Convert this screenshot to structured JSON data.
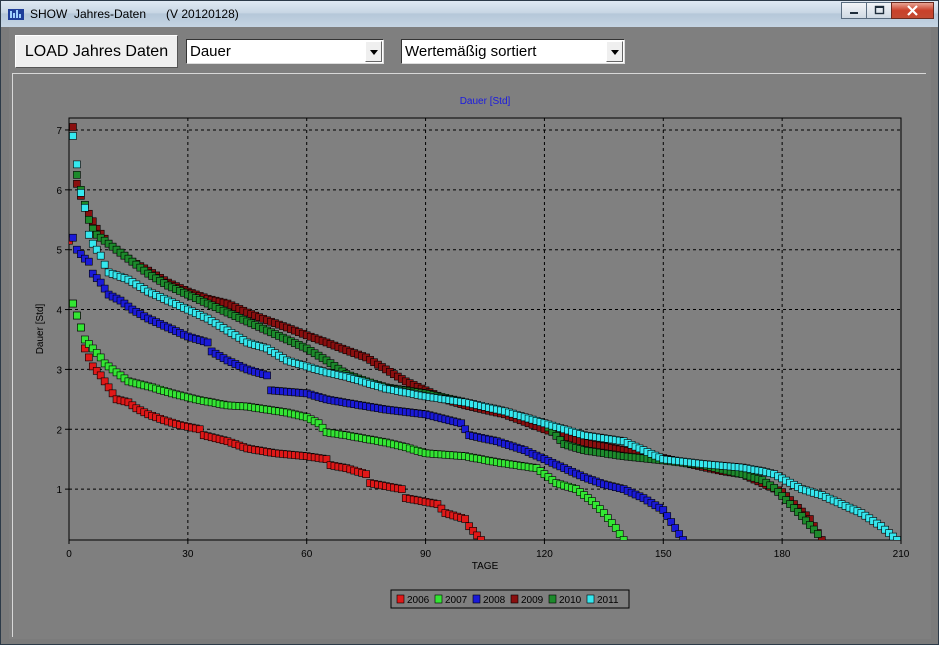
{
  "window": {
    "title": "SHOW  Jahres-Daten      (V 20120128)",
    "buttons": [
      "minimize",
      "maximize",
      "close"
    ]
  },
  "toolbar": {
    "load_label": "LOAD Jahres Daten",
    "measure_select": "Dauer",
    "sort_select": "Wertemäßig sortiert"
  },
  "colors": {
    "2006": "#e01818",
    "2007": "#33e633",
    "2008": "#1a1ad8",
    "2009": "#8a0f0f",
    "2010": "#1d8a2c",
    "2011": "#35e8ef",
    "plot_bg": "#808080",
    "title_color": "#1a1ae0"
  },
  "chart_data": {
    "type": "scatter",
    "title": "Dauer   [Std]",
    "xlabel": "TAGE",
    "ylabel": "Dauer   [Std]",
    "xlim": [
      0,
      210
    ],
    "ylim": [
      0.15,
      7.2
    ],
    "xticks": [
      "0",
      "30",
      "60",
      "90",
      "120",
      "150",
      "180",
      "210"
    ],
    "yticks": [
      "1",
      "2",
      "3",
      "4",
      "5",
      "6",
      "7"
    ],
    "grid": true,
    "legend_position": "bottom-center",
    "series": [
      {
        "name": "2006",
        "n": 104,
        "points": [
          [
            0,
            5.15
          ],
          [
            1,
            4.1
          ],
          [
            3,
            3.7
          ],
          [
            4,
            3.35
          ],
          [
            5,
            3.2
          ],
          [
            6,
            3.05
          ],
          [
            8,
            2.9
          ],
          [
            10,
            2.7
          ],
          [
            11,
            2.6
          ],
          [
            12,
            2.5
          ],
          [
            15,
            2.45
          ],
          [
            17,
            2.35
          ],
          [
            20,
            2.25
          ],
          [
            24,
            2.15
          ],
          [
            28,
            2.07
          ],
          [
            33,
            2.0
          ],
          [
            34,
            1.9
          ],
          [
            40,
            1.8
          ],
          [
            45,
            1.68
          ],
          [
            52,
            1.6
          ],
          [
            60,
            1.55
          ],
          [
            65,
            1.5
          ],
          [
            66,
            1.4
          ],
          [
            70,
            1.35
          ],
          [
            75,
            1.25
          ],
          [
            76,
            1.1
          ],
          [
            84,
            1.0
          ],
          [
            85,
            0.85
          ],
          [
            93,
            0.75
          ],
          [
            95,
            0.6
          ],
          [
            100,
            0.5
          ],
          [
            101,
            0.38
          ],
          [
            104,
            0.15
          ]
        ]
      },
      {
        "name": "2007",
        "n": 140,
        "points": [
          [
            1,
            4.1
          ],
          [
            4,
            3.5
          ],
          [
            6,
            3.35
          ],
          [
            8,
            3.2
          ],
          [
            9,
            3.1
          ],
          [
            12,
            2.95
          ],
          [
            15,
            2.8
          ],
          [
            21,
            2.7
          ],
          [
            26,
            2.6
          ],
          [
            32,
            2.5
          ],
          [
            40,
            2.4
          ],
          [
            45,
            2.38
          ],
          [
            55,
            2.28
          ],
          [
            60,
            2.2
          ],
          [
            63,
            2.1
          ],
          [
            65,
            1.95
          ],
          [
            70,
            1.9
          ],
          [
            80,
            1.78
          ],
          [
            85,
            1.7
          ],
          [
            90,
            1.6
          ],
          [
            100,
            1.55
          ],
          [
            108,
            1.45
          ],
          [
            118,
            1.35
          ],
          [
            120,
            1.25
          ],
          [
            123,
            1.1
          ],
          [
            128,
            1.0
          ],
          [
            132,
            0.8
          ],
          [
            135,
            0.6
          ],
          [
            138,
            0.35
          ],
          [
            140,
            0.15
          ]
        ]
      },
      {
        "name": "2008",
        "n": 156,
        "points": [
          [
            1,
            5.2
          ],
          [
            2,
            5.0
          ],
          [
            4,
            4.85
          ],
          [
            5,
            4.8
          ],
          [
            6,
            4.6
          ],
          [
            8,
            4.45
          ],
          [
            10,
            4.25
          ],
          [
            13,
            4.15
          ],
          [
            16,
            4.0
          ],
          [
            20,
            3.85
          ],
          [
            25,
            3.7
          ],
          [
            30,
            3.55
          ],
          [
            35,
            3.45
          ],
          [
            36,
            3.3
          ],
          [
            40,
            3.15
          ],
          [
            45,
            3.0
          ],
          [
            50,
            2.9
          ],
          [
            51,
            2.65
          ],
          [
            60,
            2.6
          ],
          [
            65,
            2.5
          ],
          [
            71,
            2.43
          ],
          [
            80,
            2.33
          ],
          [
            90,
            2.25
          ],
          [
            99,
            2.1
          ],
          [
            101,
            1.9
          ],
          [
            108,
            1.8
          ],
          [
            115,
            1.65
          ],
          [
            120,
            1.5
          ],
          [
            125,
            1.35
          ],
          [
            130,
            1.2
          ],
          [
            135,
            1.08
          ],
          [
            140,
            1.0
          ],
          [
            145,
            0.85
          ],
          [
            150,
            0.65
          ],
          [
            152,
            0.45
          ],
          [
            155,
            0.15
          ]
        ]
      },
      {
        "name": "2009",
        "n": 190,
        "points": [
          [
            1,
            7.05
          ],
          [
            2,
            6.1
          ],
          [
            3,
            5.9
          ],
          [
            5,
            5.6
          ],
          [
            7,
            5.35
          ],
          [
            10,
            5.1
          ],
          [
            13,
            4.95
          ],
          [
            16,
            4.8
          ],
          [
            20,
            4.65
          ],
          [
            25,
            4.45
          ],
          [
            30,
            4.3
          ],
          [
            35,
            4.18
          ],
          [
            40,
            4.1
          ],
          [
            45,
            3.95
          ],
          [
            50,
            3.82
          ],
          [
            55,
            3.7
          ],
          [
            60,
            3.57
          ],
          [
            65,
            3.45
          ],
          [
            70,
            3.32
          ],
          [
            75,
            3.2
          ],
          [
            80,
            3.0
          ],
          [
            85,
            2.8
          ],
          [
            90,
            2.65
          ],
          [
            95,
            2.5
          ],
          [
            100,
            2.4
          ],
          [
            110,
            2.25
          ],
          [
            120,
            2.0
          ],
          [
            130,
            1.78
          ],
          [
            140,
            1.65
          ],
          [
            150,
            1.52
          ],
          [
            158,
            1.4
          ],
          [
            165,
            1.3
          ],
          [
            170,
            1.25
          ],
          [
            175,
            1.1
          ],
          [
            180,
            0.95
          ],
          [
            183,
            0.75
          ],
          [
            187,
            0.5
          ],
          [
            190,
            0.15
          ]
        ]
      },
      {
        "name": "2010",
        "n": 189,
        "points": [
          [
            2,
            6.25
          ],
          [
            3,
            6.0
          ],
          [
            4,
            5.75
          ],
          [
            5,
            5.5
          ],
          [
            6,
            5.35
          ],
          [
            7,
            5.25
          ],
          [
            10,
            5.1
          ],
          [
            15,
            4.85
          ],
          [
            20,
            4.6
          ],
          [
            25,
            4.4
          ],
          [
            30,
            4.25
          ],
          [
            35,
            4.1
          ],
          [
            40,
            3.95
          ],
          [
            45,
            3.8
          ],
          [
            50,
            3.65
          ],
          [
            55,
            3.5
          ],
          [
            60,
            3.35
          ],
          [
            65,
            3.15
          ],
          [
            70,
            2.92
          ],
          [
            75,
            2.8
          ],
          [
            80,
            2.7
          ],
          [
            90,
            2.6
          ],
          [
            100,
            2.45
          ],
          [
            110,
            2.3
          ],
          [
            120,
            2.1
          ],
          [
            125,
            1.75
          ],
          [
            130,
            1.65
          ],
          [
            140,
            1.55
          ],
          [
            150,
            1.48
          ],
          [
            160,
            1.4
          ],
          [
            170,
            1.25
          ],
          [
            175,
            1.15
          ],
          [
            178,
            1.02
          ],
          [
            182,
            0.75
          ],
          [
            185,
            0.55
          ],
          [
            189,
            0.25
          ]
        ]
      },
      {
        "name": "2011",
        "n": 209,
        "points": [
          [
            1,
            6.9
          ],
          [
            3,
            5.95
          ],
          [
            4,
            5.7
          ],
          [
            5,
            5.25
          ],
          [
            6,
            5.1
          ],
          [
            8,
            4.9
          ],
          [
            9,
            4.75
          ],
          [
            10,
            4.62
          ],
          [
            15,
            4.5
          ],
          [
            20,
            4.3
          ],
          [
            25,
            4.15
          ],
          [
            30,
            4.0
          ],
          [
            35,
            3.85
          ],
          [
            40,
            3.65
          ],
          [
            45,
            3.45
          ],
          [
            50,
            3.35
          ],
          [
            55,
            3.15
          ],
          [
            60,
            3.05
          ],
          [
            65,
            2.95
          ],
          [
            70,
            2.88
          ],
          [
            75,
            2.78
          ],
          [
            80,
            2.68
          ],
          [
            90,
            2.55
          ],
          [
            100,
            2.45
          ],
          [
            110,
            2.3
          ],
          [
            120,
            2.1
          ],
          [
            125,
            2.0
          ],
          [
            130,
            1.9
          ],
          [
            140,
            1.8
          ],
          [
            145,
            1.65
          ],
          [
            150,
            1.5
          ],
          [
            160,
            1.42
          ],
          [
            170,
            1.36
          ],
          [
            175,
            1.3
          ],
          [
            178,
            1.25
          ],
          [
            185,
            1.0
          ],
          [
            190,
            0.9
          ],
          [
            195,
            0.75
          ],
          [
            200,
            0.6
          ],
          [
            205,
            0.38
          ],
          [
            209,
            0.15
          ]
        ]
      }
    ]
  }
}
